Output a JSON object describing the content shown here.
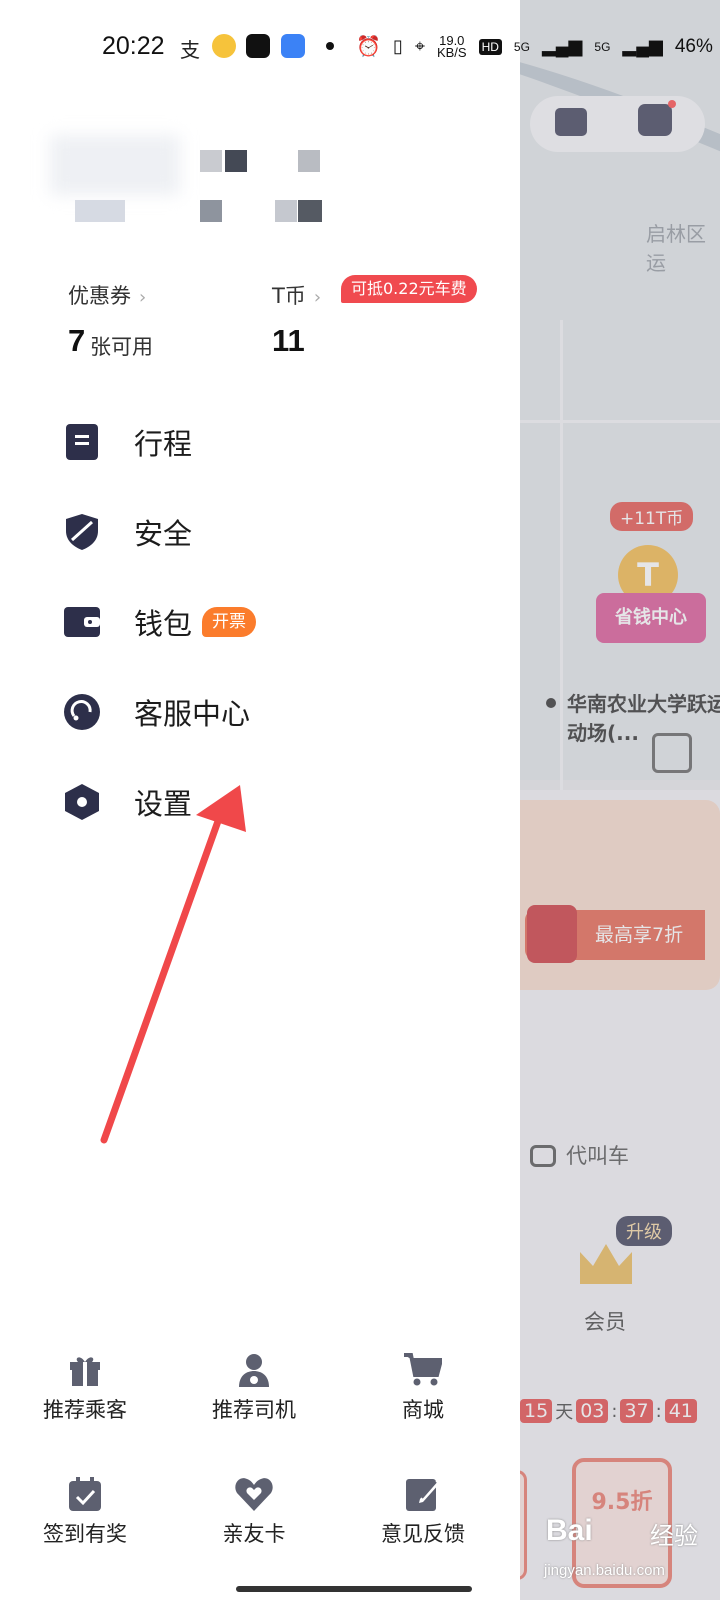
{
  "status_bar": {
    "time": "20:22",
    "net_speed": "19.0\nKB/S",
    "hd": "HD",
    "signal1": "5G",
    "signal2": "5G",
    "battery": "46%"
  },
  "drawer": {
    "coupon": {
      "title": "优惠券",
      "count": "7",
      "unit": "张可用"
    },
    "tcoin": {
      "title": "T币",
      "value": "11",
      "badge": "可抵0.22元车费"
    },
    "menu": [
      {
        "label": "行程",
        "icon": "itinerary-icon"
      },
      {
        "label": "安全",
        "icon": "shield-icon"
      },
      {
        "label": "钱包",
        "icon": "wallet-icon",
        "tag": "开票"
      },
      {
        "label": "客服中心",
        "icon": "headset-icon"
      },
      {
        "label": "设置",
        "icon": "settings-hexagon-icon"
      }
    ],
    "grid": [
      {
        "label": "推荐乘客",
        "icon": "gift-icon"
      },
      {
        "label": "推荐司机",
        "icon": "driver-icon"
      },
      {
        "label": "商城",
        "icon": "cart-icon"
      },
      {
        "label": "签到有奖",
        "icon": "calendar-check-icon"
      },
      {
        "label": "亲友卡",
        "icon": "heart-card-icon"
      },
      {
        "label": "意见反馈",
        "icon": "edit-note-icon"
      }
    ]
  },
  "background": {
    "area_label": "启林区运",
    "tcoin_bubble": "+11T币",
    "save_center": "省钱中心",
    "poi": "华南农业大学跃运动场(...",
    "promo": "最高享7折",
    "daijiao": "代叫车",
    "upgrade": "升级",
    "member": "会员",
    "countdown": {
      "days": "15",
      "day_unit": "天",
      "h": "03",
      "m": "37",
      "s": "41"
    },
    "deal": "9.5折"
  },
  "watermark": {
    "brand": "Bai",
    "jingyan": "经验",
    "url": "jingyan.baidu.com"
  },
  "colors": {
    "accent_red": "#f04a4f",
    "tag_orange": "#fb7c2c",
    "icon_dark": "#2d2f4a",
    "arrow": "#f0484a"
  }
}
